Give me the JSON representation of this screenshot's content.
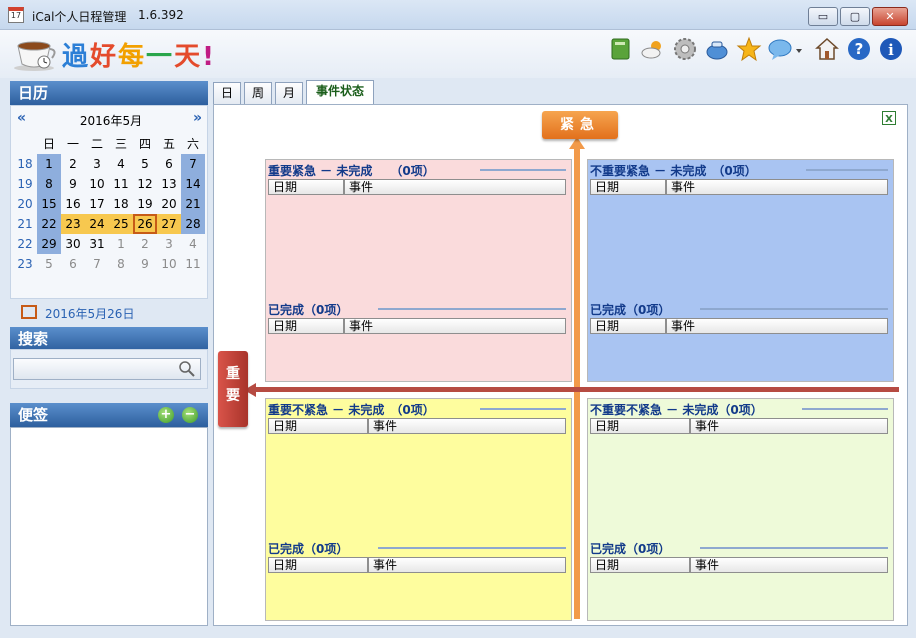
{
  "window": {
    "title": "iCal个人日程管理",
    "version": "1.6.392",
    "btn_min": "▭",
    "btn_max": "▢",
    "btn_close": "✕"
  },
  "logo": {
    "chars": [
      "過",
      "好",
      "每",
      "一",
      "天",
      "!"
    ]
  },
  "toolbar": {
    "icons": [
      "book-icon",
      "weather-icon",
      "gear-icon",
      "tea-icon",
      "star-icon",
      "chat-icon",
      "home-icon",
      "help-icon",
      "info-icon"
    ]
  },
  "calendar": {
    "header": "日历",
    "prev": "«",
    "next": "»",
    "month_label": "2016年5月",
    "weekday_headers": [
      "日",
      "一",
      "二",
      "三",
      "四",
      "五",
      "六"
    ],
    "weeks": [
      {
        "wk": "18",
        "days": [
          "1",
          "2",
          "3",
          "4",
          "5",
          "6",
          "7"
        ]
      },
      {
        "wk": "19",
        "days": [
          "8",
          "9",
          "10",
          "11",
          "12",
          "13",
          "14"
        ]
      },
      {
        "wk": "20",
        "days": [
          "15",
          "16",
          "17",
          "18",
          "19",
          "20",
          "21"
        ]
      },
      {
        "wk": "21",
        "days": [
          "22",
          "23",
          "24",
          "25",
          "26",
          "27",
          "28"
        ]
      },
      {
        "wk": "22",
        "days": [
          "29",
          "30",
          "31",
          "1",
          "2",
          "3",
          "4"
        ]
      },
      {
        "wk": "23",
        "days": [
          "5",
          "6",
          "7",
          "8",
          "9",
          "10",
          "11"
        ]
      }
    ],
    "today_label": "2016年5月26日"
  },
  "search": {
    "header": "搜索",
    "value": ""
  },
  "notes": {
    "header": "便签",
    "add": "+",
    "remove": "−"
  },
  "tabs": [
    "日",
    "周",
    "月",
    "事件状态"
  ],
  "matrix": {
    "urgent_label": "紧急",
    "important_label": "重要",
    "quadrants": [
      {
        "title": "重要紧急 － 未完成　　（0项）",
        "done_title": "已完成（0项）",
        "col_date": "日期",
        "col_event": "事件"
      },
      {
        "title": "不重要紧急 － 未完成　（0项）",
        "done_title": "已完成（0项）",
        "col_date": "日期",
        "col_event": "事件"
      },
      {
        "title": "重要不紧急 － 未完成　（0项）",
        "done_title": "已完成（0项）",
        "col_date": "日期",
        "col_event": "事件"
      },
      {
        "title": "不重要不紧急 － 未完成（0项）",
        "done_title": "已完成（0项）",
        "col_date": "日期",
        "col_event": "事件"
      }
    ]
  },
  "colors": {
    "urgent": "#e2701c",
    "important": "#b64b42",
    "q1": "#fadbdc",
    "q2": "#a9c4f2",
    "q3": "#fefd9e",
    "q4": "#eefad9"
  }
}
